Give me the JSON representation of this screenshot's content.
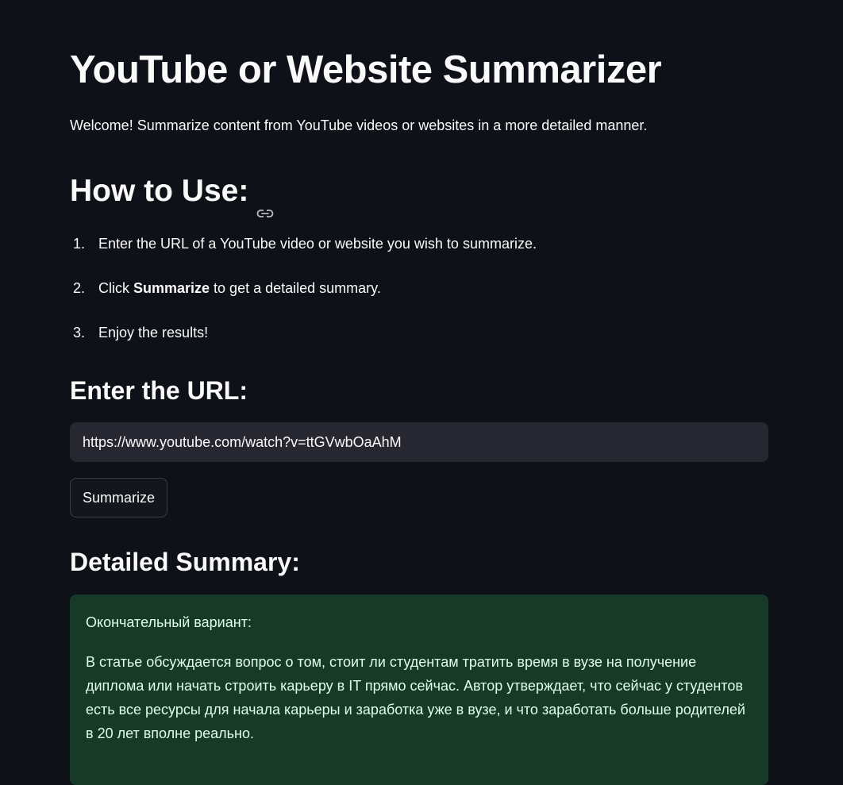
{
  "page": {
    "title": "YouTube or Website Summarizer",
    "welcome": "Welcome! Summarize content from YouTube videos or websites in a more detailed manner."
  },
  "how_to": {
    "heading": "How to Use:",
    "steps": [
      {
        "num": "1.",
        "text": "Enter the URL of a YouTube video or website you wish to summarize."
      },
      {
        "num": "2.",
        "prefix": "Click ",
        "bold": "Summarize",
        "suffix": " to get a detailed summary."
      },
      {
        "num": "3.",
        "text": "Enjoy the results!"
      }
    ]
  },
  "url_section": {
    "heading": "Enter the URL:",
    "input_value": "https://www.youtube.com/watch?v=ttGVwbOaAhM",
    "button_label": "Summarize"
  },
  "summary": {
    "heading": "Detailed Summary:",
    "paragraphs": [
      "Окончательный вариант:",
      "В статье обсуждается вопрос о том, стоит ли студентам тратить время в вузе на получение диплома или начать строить карьеру в IT прямо сейчас. Автор утверждает, что сейчас у студентов есть все ресурсы для начала карьеры и заработка уже в вузе, и что заработать больше родителей в 20 лет вполне реально."
    ]
  },
  "colors": {
    "background": "#0e1117",
    "input_bg": "#262730",
    "success_bg": "#173928",
    "success_text": "#dffde9"
  },
  "icons": {
    "heading_anchor": "link-icon"
  }
}
